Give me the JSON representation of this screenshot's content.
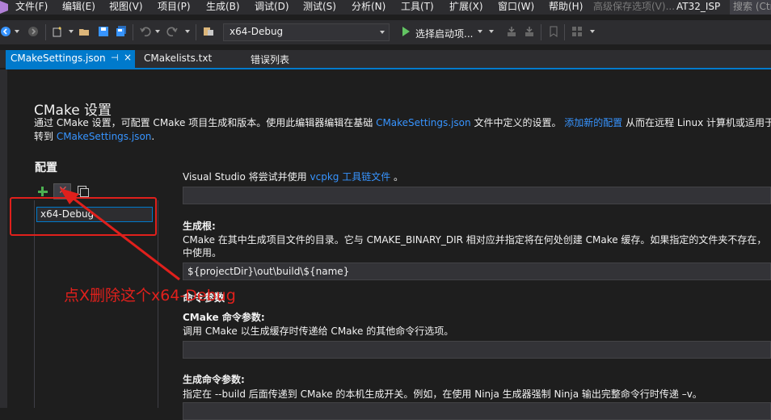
{
  "menu": {
    "items": [
      "文件(F)",
      "编辑(E)",
      "视图(V)",
      "项目(P)",
      "生成(B)",
      "调试(D)",
      "测试(S)",
      "分析(N)",
      "工具(T)",
      "扩展(X)",
      "窗口(W)",
      "帮助(H)"
    ],
    "advanced_save": "高级保存选项(V)...",
    "project_name": "AT32_ISP",
    "search_placeholder": "搜索 (Ctrl+Q)"
  },
  "toolbar": {
    "configuration": "x64-Debug",
    "start_item": "选择启动项..."
  },
  "tabs": {
    "active": "CMakeSettings.json",
    "active_pin": "⊣",
    "active_close": "×",
    "second": "CMakelists.txt",
    "third": "错误列表"
  },
  "page": {
    "title": "CMake 设置",
    "desc1_a": "通过 CMake 设置，可配置 CMake 项目生成和版本。使用此编辑器编辑在基础 ",
    "desc1_link1": "CMakeSettings.json",
    "desc1_b": " 文件中定义的设置。 ",
    "desc1_link2": "添加新的配置",
    "desc1_c": " 从而在远程 Linux 计算机或适用于",
    "desc2_a": "转到 ",
    "desc2_link": "CMakeSettings.json",
    "desc2_b": "."
  },
  "config_panel": {
    "heading": "配置",
    "add_symbol": "+",
    "delete_symbol": "✕",
    "selected": "x64-Debug"
  },
  "annotation": {
    "text": "点X删除这个x64-Debug"
  },
  "form": {
    "vcpkg_a": "Visual Studio 将尝试并使用 ",
    "vcpkg_link": "vcpkg 工具链文件",
    "vcpkg_b": " 。",
    "vcpkg_value": "",
    "build_root_label": "生成根:",
    "build_root_desc1": "CMake 在其中生成项目文件的目录。它与 CMAKE_BINARY_DIR 相对应并指定将在何处创建 CMake 缓存。如果指定的文件夹不存在，",
    "build_root_desc2": "中使用。",
    "build_root_value": "${projectDir}\\out\\build\\${name}",
    "cmd_section": "命令参数",
    "cmake_args_label": "CMake 命令参数:",
    "cmake_args_desc": "调用 CMake 以生成缓存时传递给 CMake 的其他命令行选项。",
    "cmake_args_value": "",
    "build_args_label": "生成命令参数:",
    "build_args_desc": "指定在 --build 后面传递到 CMake 的本机生成开关。例如，在使用 Ninja 生成器强制 Ninja 输出完整命令行时传递 –v。"
  },
  "colors": {
    "accent": "#007acc",
    "annotation": "#e0201c",
    "link": "#3794ff",
    "background": "#1e1e1e"
  }
}
